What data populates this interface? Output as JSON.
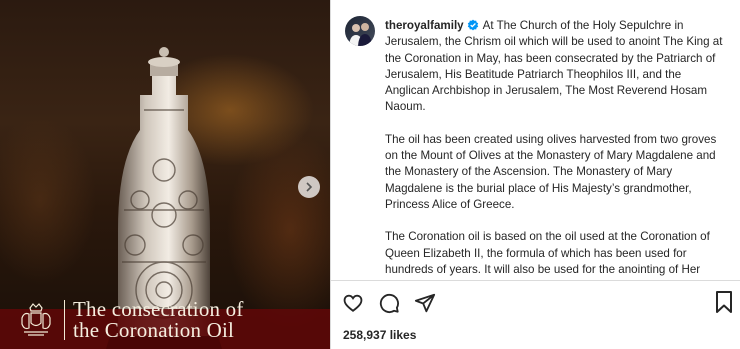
{
  "post": {
    "username": "theroyalfamily",
    "paragraphs": [
      "At The Church of the Holy Sepulchre in Jerusalem, the Chrism oil which will be used to anoint The King at the Coronation in May, has been consecrated by the Patriarch of Jerusalem, His Beatitude Patriarch Theophilos III, and the Anglican Archbishop in Jerusalem, The Most Reverend Hosam Naoum.",
      "The oil has been created using olives harvested from two groves on the Mount of Olives at the Monastery of Mary Magdalene and the Monastery of the Ascension. The Monastery of Mary Magdalene is the burial place of His Majesty’s grandmother, Princess Alice of Greece.",
      "The Coronation oil is based on the oil used at the Coronation of Queen Elizabeth II, the formula of which has been used for hundreds of years. It will also be used for the anointing of Her Majesty The Queen Consort."
    ],
    "likes": "258,937 likes"
  },
  "media": {
    "caption_line1": "The consecration of",
    "caption_line2": "the Coronation Oil"
  },
  "icons": {
    "verified": "verified-badge-icon",
    "like": "heart-icon",
    "comment": "comment-icon",
    "share": "share-icon",
    "save": "bookmark-icon",
    "next": "chevron-right-icon",
    "crest": "royal-crest-icon"
  },
  "colors": {
    "verified": "#0095f6",
    "text": "#262626",
    "divider": "#dbdbdb"
  }
}
